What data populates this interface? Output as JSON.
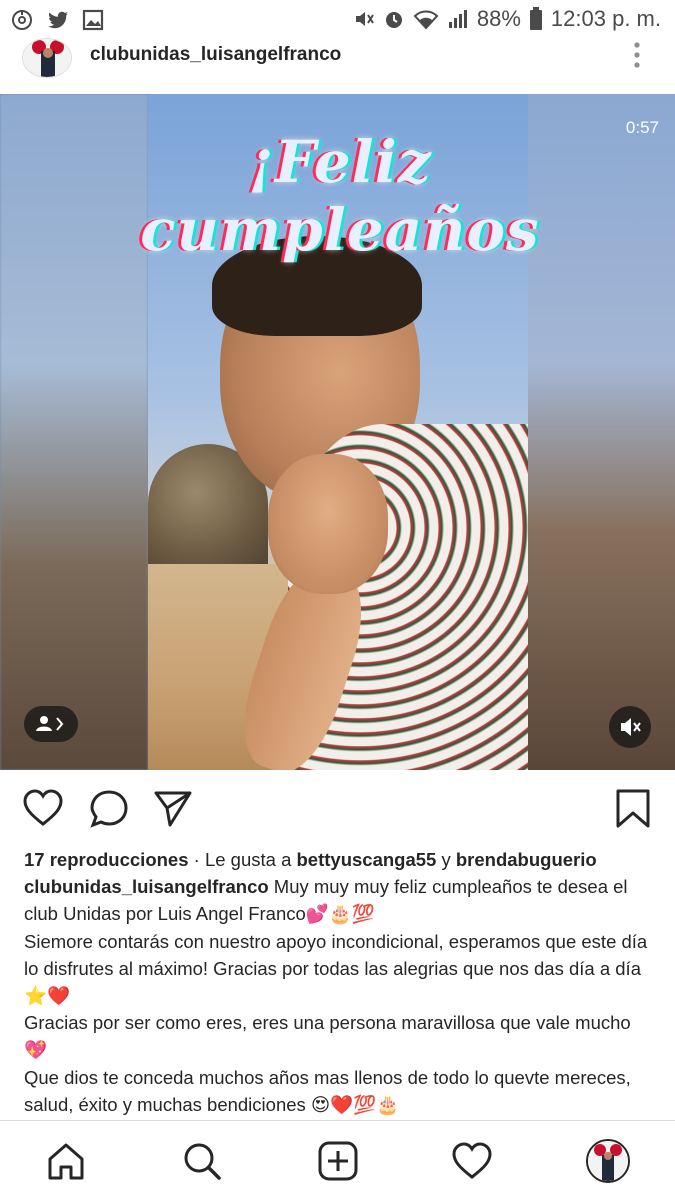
{
  "status_bar": {
    "battery": "88%",
    "time": "12:03 p. m."
  },
  "post": {
    "username": "clubunidas_luisangelfranco",
    "overlay_title": "¡Feliz cumpleaños",
    "video_timer": "0:57"
  },
  "stats": {
    "views": "17 reproducciones",
    "liked_prefix": " · Le gusta a ",
    "liker_1": "bettyuscanga55",
    "liked_join": " y ",
    "liker_2": "brendabuguerio"
  },
  "caption": {
    "author": "clubunidas_luisangelfranco",
    "line1": " Muy muy muy feliz cumpleaños te desea el club Unidas por Luis Angel Franco💕🎂💯",
    "line2": "Siemore contarás con nuestro apoyo incondicional, esperamos que este día lo disfrutes al máximo! Gracias por todas las alegrias que nos das día a día ⭐❤️",
    "line3": "Gracias por ser como eres, eres una persona maravillosa que vale mucho 💖",
    "line4": "Que dios te conceda muchos años mas llenos de todo lo quevte mereces, salud, éxito y muchas bendiciones 😍❤️💯🎂"
  },
  "icons": {
    "status_left": [
      "sync-icon",
      "twitter-icon",
      "image-icon"
    ],
    "status_right": [
      "mute-icon",
      "alarm-icon",
      "wifi-icon",
      "signal-icon",
      "battery-icon"
    ],
    "actions": [
      "like-icon",
      "comment-icon",
      "share-icon",
      "bookmark-icon"
    ],
    "nav": [
      "home-icon",
      "search-icon",
      "add-post-icon",
      "activity-icon",
      "profile-avatar"
    ]
  }
}
